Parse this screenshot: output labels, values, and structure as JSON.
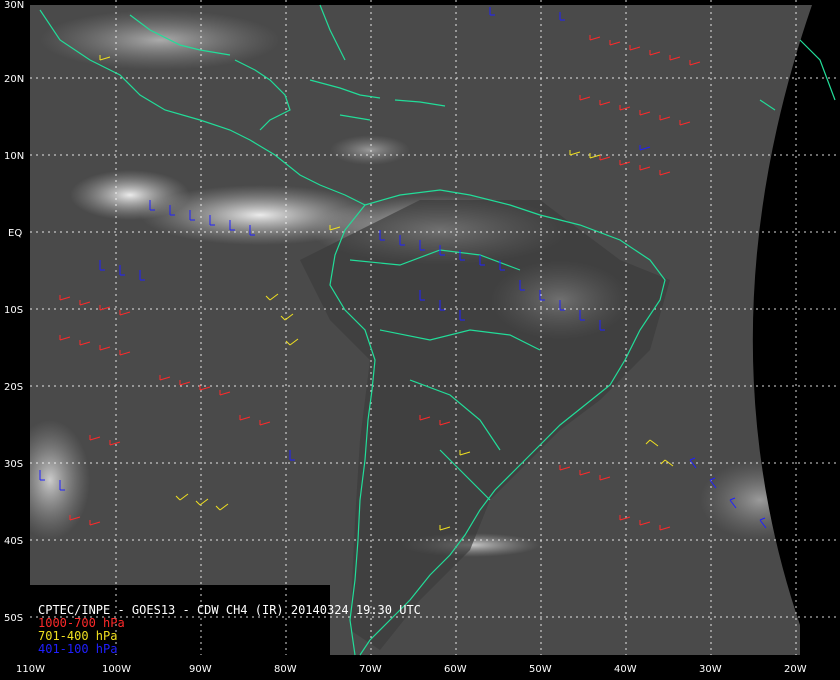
{
  "title": "CPTEC/INPE - GOES13 - CDW CH4 (IR) 20140324 19:30 UTC",
  "latitude_labels": [
    "30N",
    "20N",
    "10N",
    "EQ",
    "10S",
    "20S",
    "30S",
    "40S",
    "50S"
  ],
  "longitude_labels": [
    "110W",
    "100W",
    "90W",
    "80W",
    "70W",
    "60W",
    "50W",
    "40W",
    "30W",
    "20W"
  ],
  "legend": [
    {
      "label": "1000-700 hPa",
      "color": "#ff2a2a"
    },
    {
      "label": "701-400 hPa",
      "color": "#f0e020"
    },
    {
      "label": "401-100 hPa",
      "color": "#2020ff"
    }
  ],
  "colors": {
    "coastline": "#22dd99",
    "grid": "#ffffff",
    "background": "#000000"
  }
}
